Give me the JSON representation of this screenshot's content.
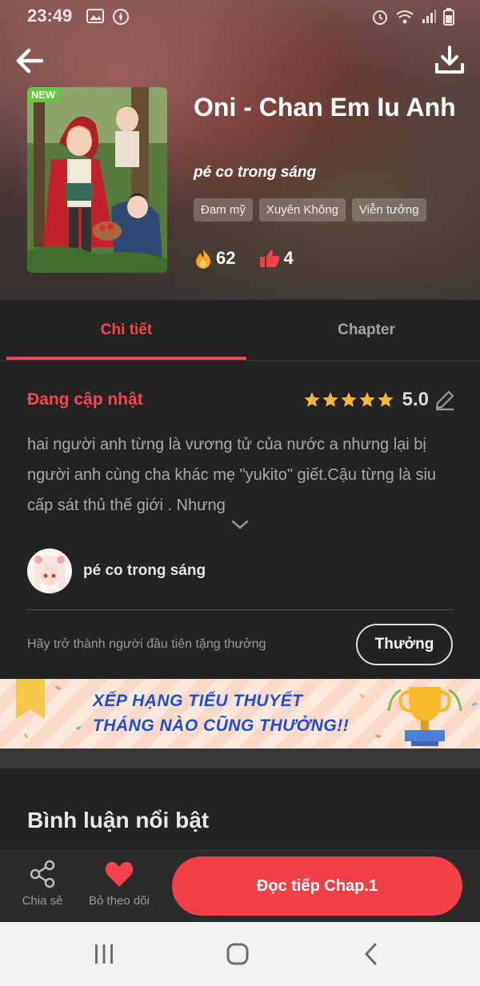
{
  "status_bar": {
    "time": "23:49"
  },
  "book": {
    "title": "Oni - Chan Em Iu Anh",
    "author": "pé co trong sáng",
    "new_badge": "NEW",
    "tags": [
      "Đam mỹ",
      "Xuyên Không",
      "Viễn tưởng"
    ],
    "views": "62",
    "likes": "4"
  },
  "tabs": {
    "detail": "Chi tiết",
    "chapter": "Chapter"
  },
  "detail": {
    "status": "Đang cập nhật",
    "rating_stars": 5,
    "rating_value": "5.0",
    "description": "hai người anh từng là vương tử của nước a nhưng lại bị người anh cùng cha khác mẹ \"yukito\" giết.Cậu từng là siu cấp sát thủ thế giới . Nhưng",
    "author_name": "pé co trong sáng",
    "reward_hint": "Hãy trở thành người đầu tiên tặng thưởng",
    "reward_button": "Thưởng"
  },
  "banner": {
    "line1": "XẾP HẠNG TIỂU THUYẾT",
    "line2": "THÁNG NÀO CŨNG THƯỞNG!!"
  },
  "comments": {
    "title": "Bình luận nổi bật"
  },
  "bottom_bar": {
    "share_label": "Chia sẻ",
    "follow_label": "Bỏ theo dõi",
    "read_button": "Đọc tiếp Chap.1"
  },
  "colors": {
    "accent": "#f2474f",
    "read_button": "#f33f46",
    "background": "#232323"
  },
  "icons": [
    "back-arrow-icon",
    "download-icon",
    "fire-icon",
    "thumbs-up-icon",
    "star-icon",
    "edit-pencil-icon",
    "chevron-down-icon",
    "share-icon",
    "heart-icon",
    "trophy-icon",
    "bookmark-ribbon-icon"
  ]
}
